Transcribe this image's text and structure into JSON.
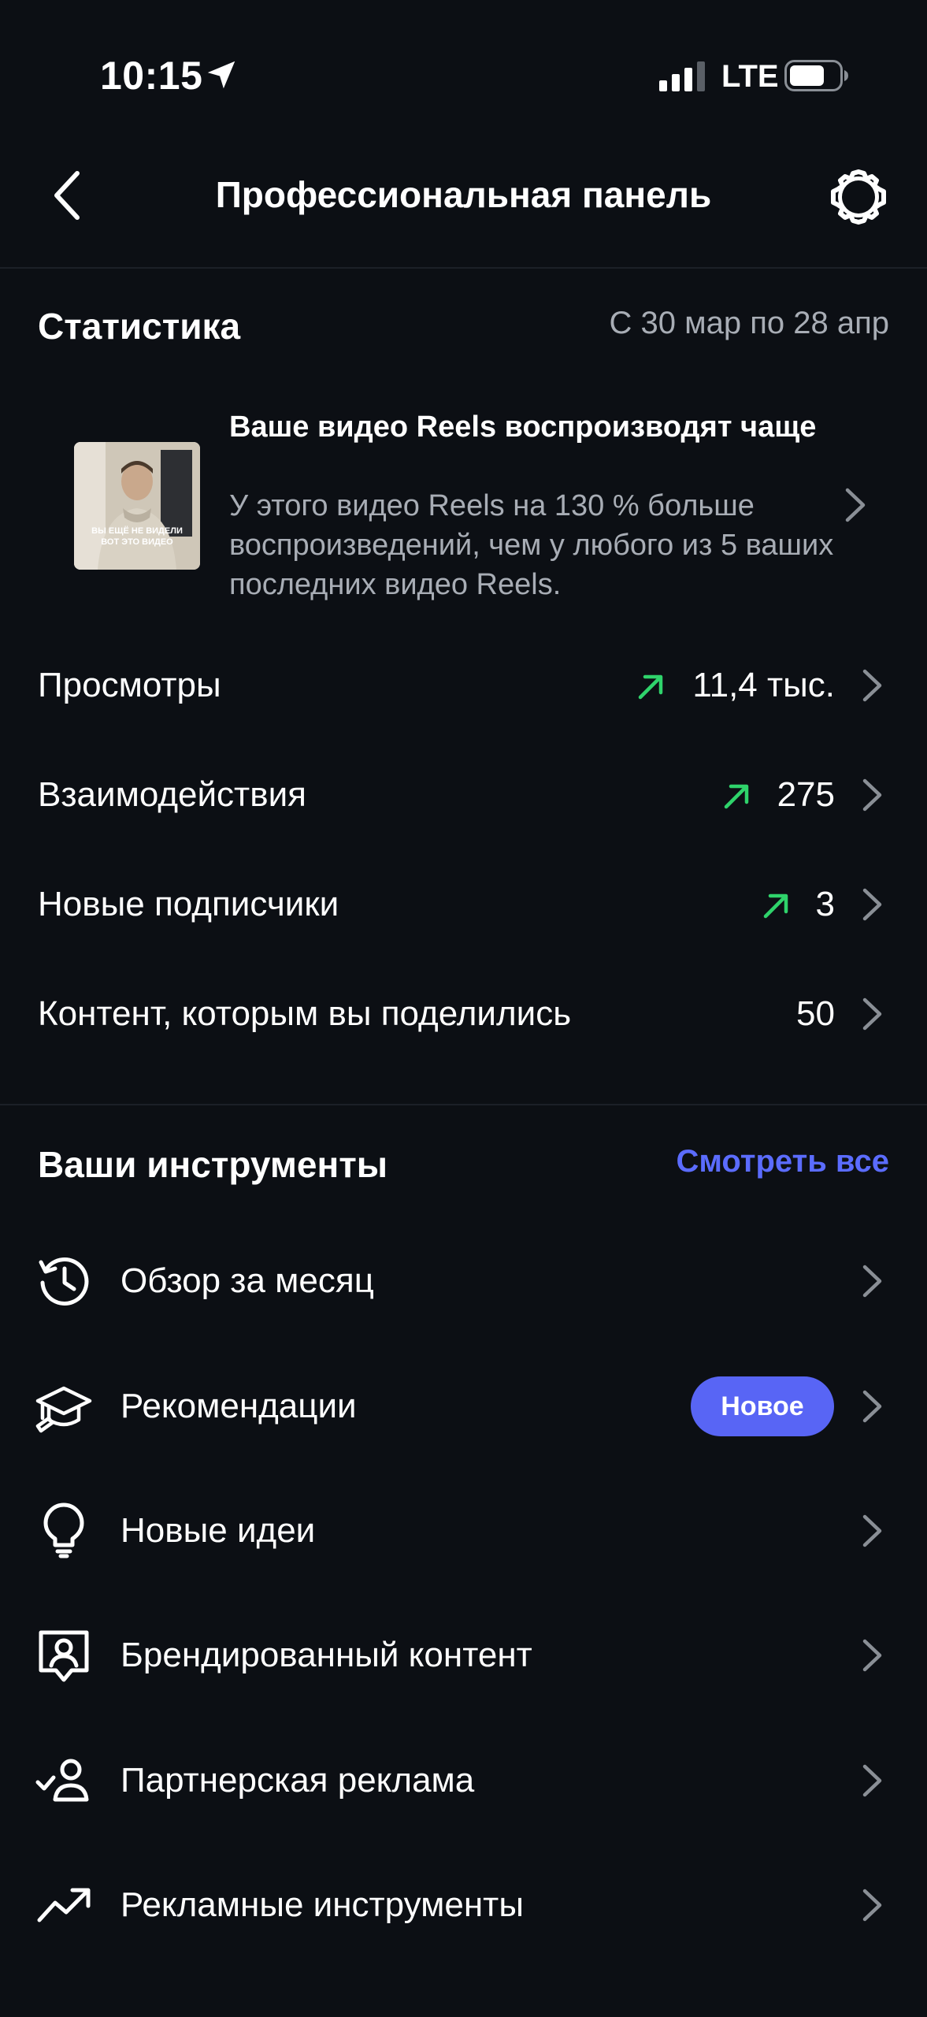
{
  "status_bar": {
    "time": "10:15",
    "network": "LTE"
  },
  "header": {
    "title": "Профессиональная панель",
    "back_icon": "chevron-left-icon",
    "settings_icon": "gear-icon"
  },
  "stats": {
    "title": "Статистика",
    "date_range": "С 30 мар по 28 апр",
    "insight": {
      "title": "Ваше видео Reels воспроизводят чаще",
      "body": "У этого видео Reels на 130 % больше воспроизведений, чем у любого из 5 ваших последних видео Reels.",
      "thumbnail_caption": "ВЫ ЕЩЁ НЕ ВИДЕЛИ ВОТ ЭТО ВИДЕО"
    },
    "rows": [
      {
        "label": "Просмотры",
        "value": "11,4 тыс.",
        "trend": "up"
      },
      {
        "label": "Взаимодействия",
        "value": "275",
        "trend": "up"
      },
      {
        "label": "Новые подписчики",
        "value": "3",
        "trend": "up"
      },
      {
        "label": "Контент, которым вы поделились",
        "value": "50",
        "trend": "none"
      }
    ]
  },
  "tools": {
    "title": "Ваши инструменты",
    "see_all": "Смотреть все",
    "items": [
      {
        "label": "Обзор за месяц",
        "icon": "history-icon"
      },
      {
        "label": "Рекомендации",
        "icon": "graduation-cap-icon",
        "badge": "Новое"
      },
      {
        "label": "Новые идеи",
        "icon": "lightbulb-icon"
      },
      {
        "label": "Брендированный контент",
        "icon": "branded-content-icon"
      },
      {
        "label": "Партнерская реклама",
        "icon": "partner-user-check-icon"
      },
      {
        "label": "Рекламные инструменты",
        "icon": "trending-up-icon"
      }
    ]
  },
  "colors": {
    "background": "#0c0f14",
    "accent": "#5b6cff",
    "trend_up": "#2fd36b",
    "secondary_text": "#a8adb5"
  }
}
